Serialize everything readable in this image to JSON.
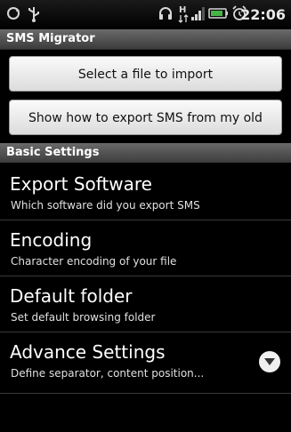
{
  "status_bar": {
    "time": "22:06",
    "icons": [
      "sync-icon",
      "usb-icon",
      "headset-icon",
      "hspa-icon",
      "signal-icon",
      "battery-icon",
      "alarm-icon"
    ]
  },
  "title": "SMS Migrator",
  "buttons": {
    "select_file": "Select a file to import",
    "show_how": "Show how to export SMS from my old phone"
  },
  "section": {
    "label": "Basic Settings"
  },
  "preferences": [
    {
      "title": "Export Software",
      "summary": "Which software did you export SMS"
    },
    {
      "title": "Encoding",
      "summary": "Character encoding of your file"
    },
    {
      "title": "Default folder",
      "summary": "Set default browsing folder"
    },
    {
      "title": "Advance Settings",
      "summary": "Define separator, content position...",
      "icon": "chevron-down-icon"
    }
  ],
  "colors": {
    "background": "#000000",
    "header": "#4e4e4e",
    "button": "#e8e8e8"
  }
}
